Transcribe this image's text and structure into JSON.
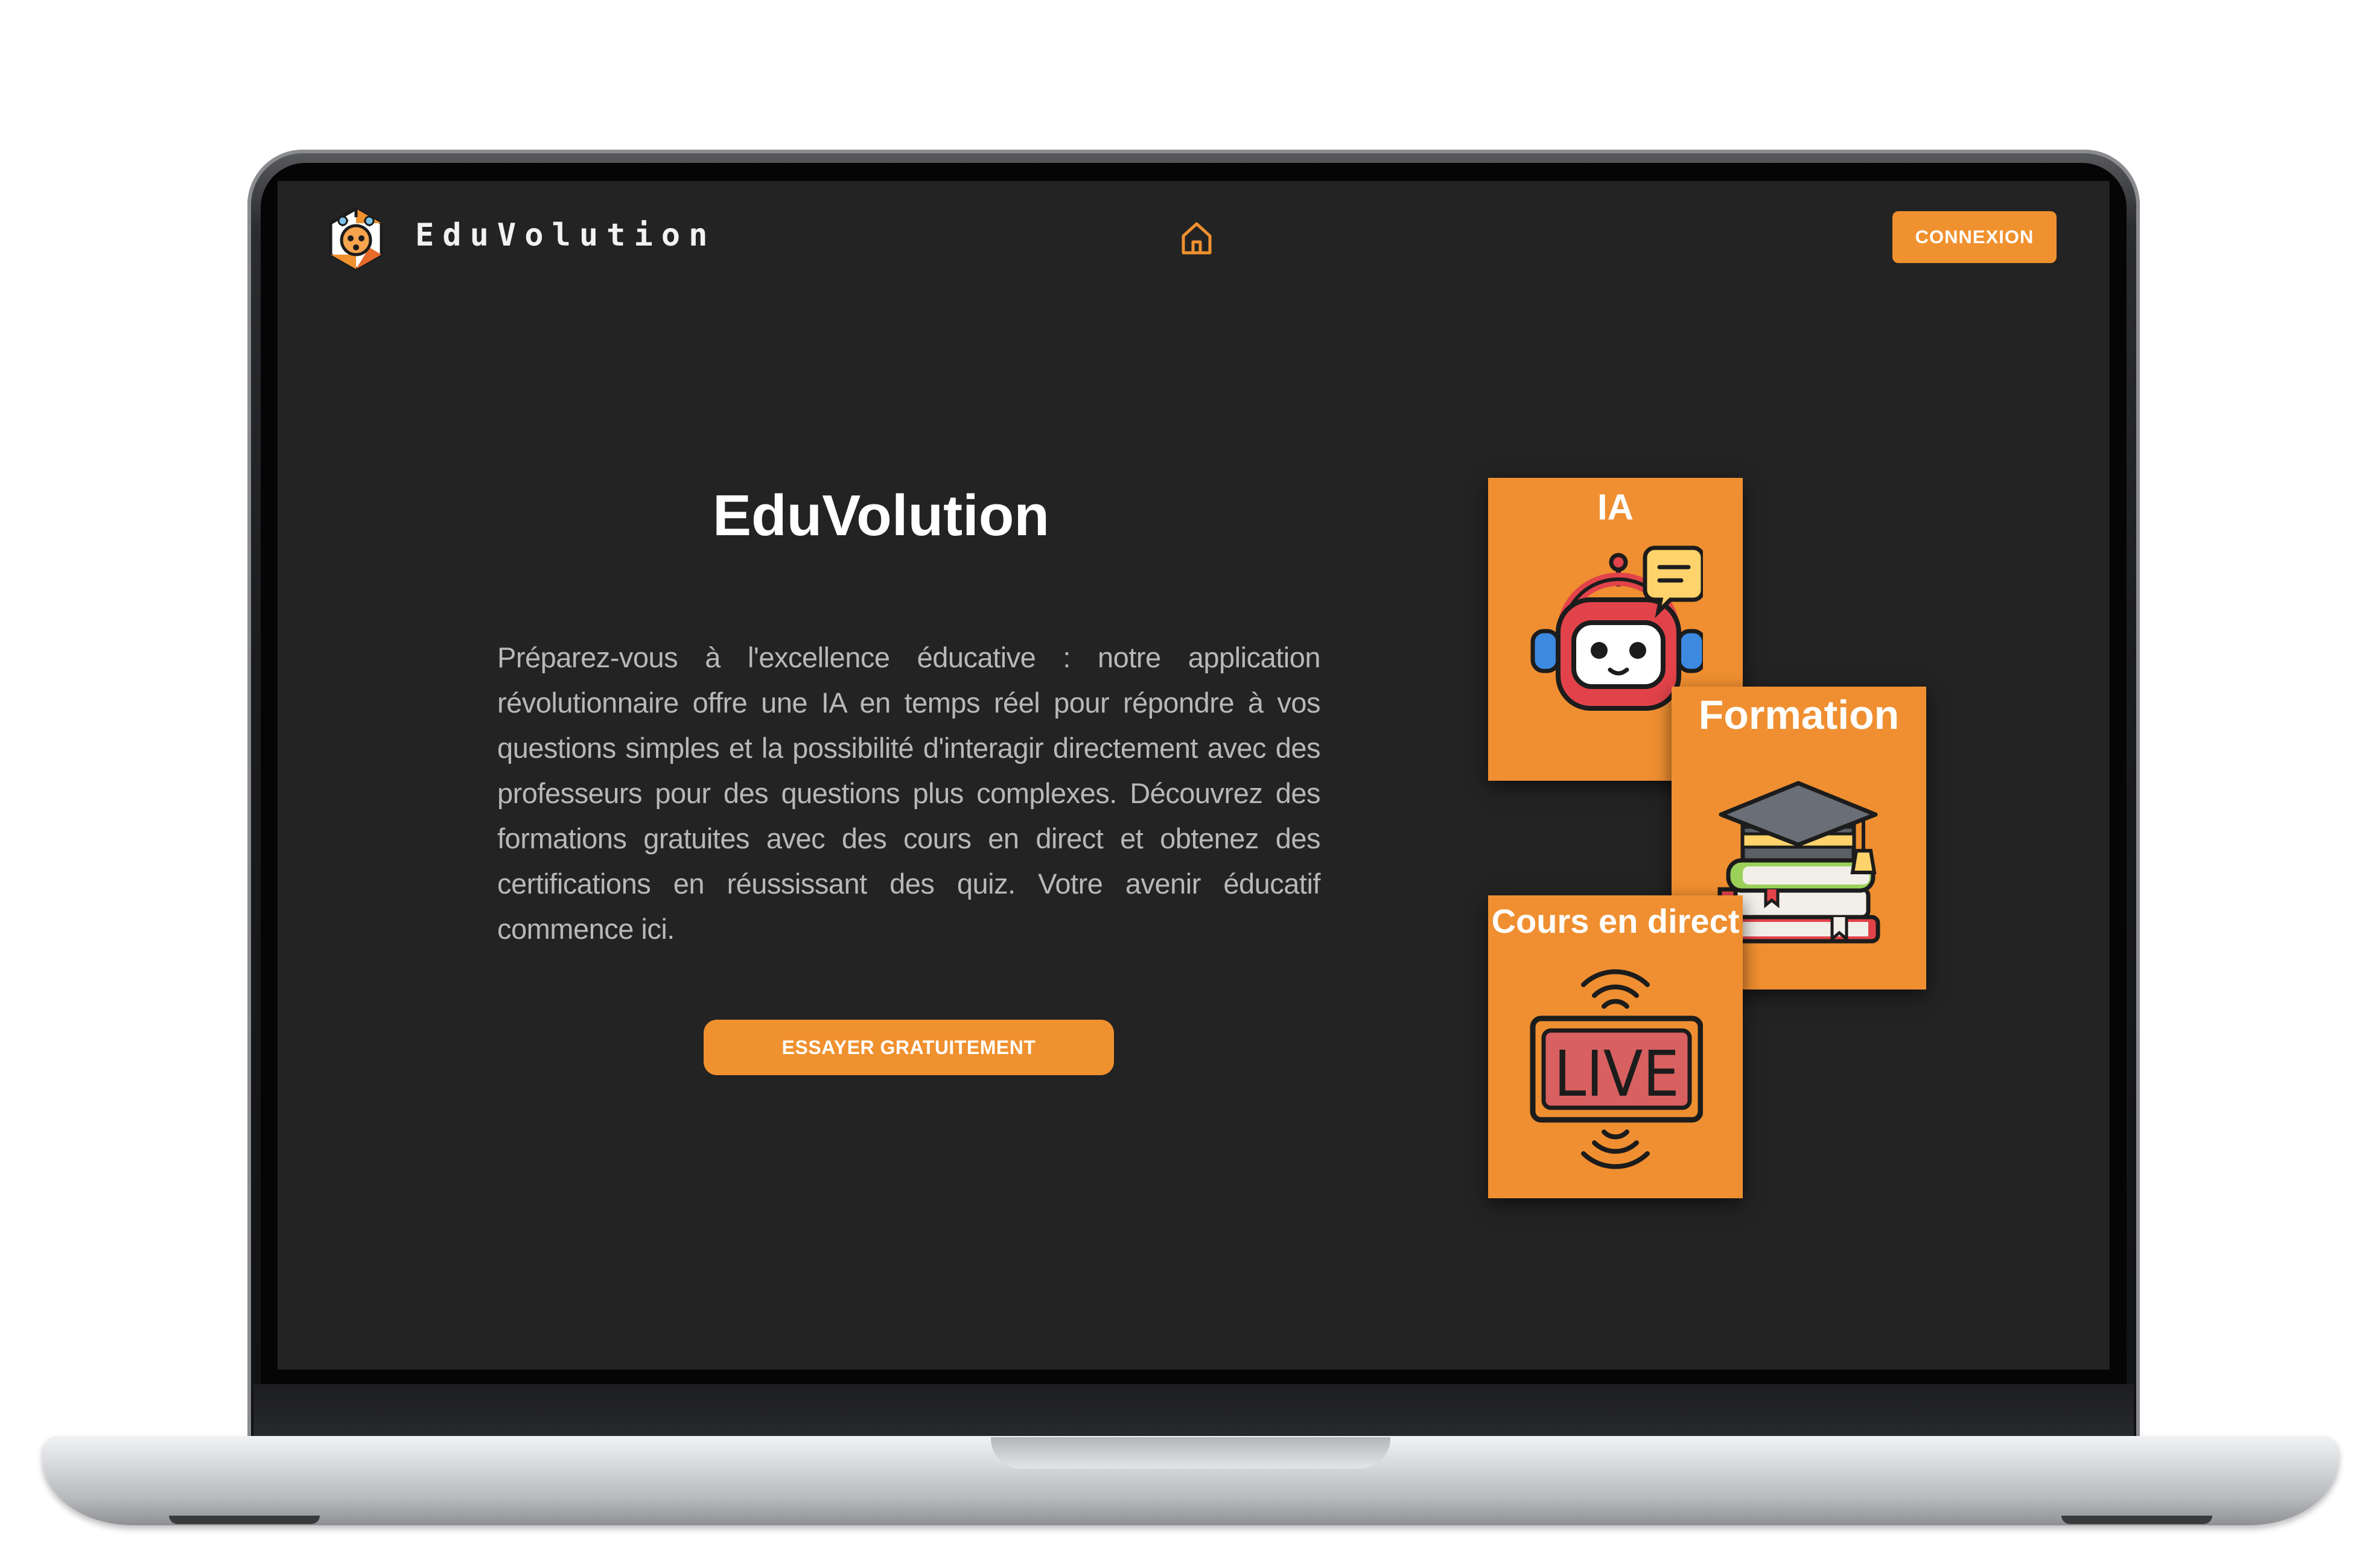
{
  "app": {
    "brand_name": "EduVolution",
    "accent_color": "#f0912f",
    "background_color": "#232323"
  },
  "navbar": {
    "home_icon": "home-icon",
    "connexion_label": "CONNEXION"
  },
  "hero": {
    "title": "EduVolution",
    "description": "Préparez-vous à l'excellence éducative : notre application révolutionnaire offre une IA en temps réel pour répondre à vos questions simples et la possibilité d'interagir directement avec des professeurs pour des questions plus complexes. Découvrez des formations gratuites avec des cours en direct et obtenez des certifications en réussissant des quiz. Votre avenir éducatif commence ici.",
    "cta_label": "ESSAYER GRATUITEMENT"
  },
  "feature_cards": [
    {
      "title": "IA",
      "icon": "robot-chat-icon"
    },
    {
      "title": "Formation",
      "icon": "graduation-books-icon"
    },
    {
      "title": "Cours en direct",
      "icon": "live-broadcast-icon"
    }
  ]
}
